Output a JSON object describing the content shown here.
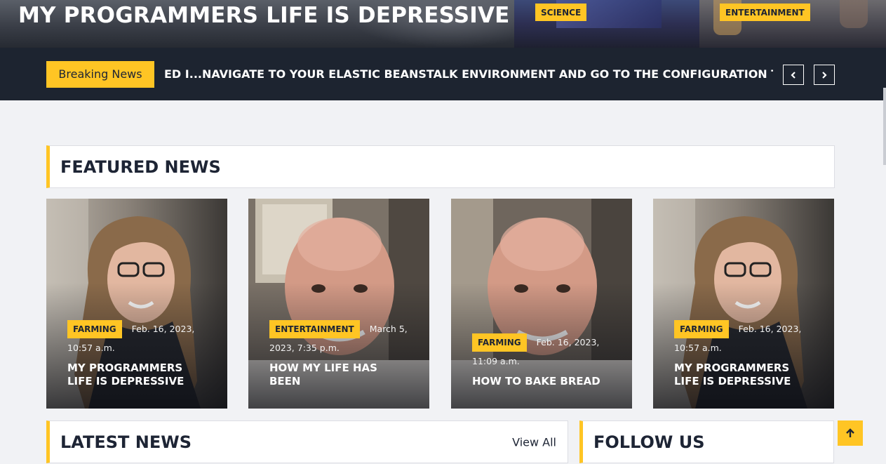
{
  "hero": {
    "title": "MY PROGRAMMERS LIFE IS DEPRESSIVE",
    "categories": [
      "SCIENCE",
      "ENTERTAINMENT"
    ]
  },
  "breaking": {
    "label": "Breaking News",
    "ticker_items": [
      "ED I...",
      "NAVIGATE TO YOUR ELASTIC BEANSTALK ENVIRONMENT AND GO TO THE CONFIGURATION TAB AN"
    ],
    "prev_icon": "chevron-left-icon",
    "next_icon": "chevron-right-icon"
  },
  "featured": {
    "title": "FEATURED NEWS",
    "cards": [
      {
        "category": "FARMING",
        "date": "Feb. 16, 2023, 10:57 a.m.",
        "headline": "MY PROGRAMMERS LIFE IS DEPRESSIVE"
      },
      {
        "category": "ENTERTAINMENT",
        "date": "March 5, 2023, 7:35 p.m.",
        "headline": "HOW MY LIFE HAS BEEN"
      },
      {
        "category": "FARMING",
        "date": "Feb. 16, 2023, 11:09 a.m.",
        "headline": "HOW TO BAKE BREAD"
      },
      {
        "category": "FARMING",
        "date": "Feb. 16, 2023, 10:57 a.m.",
        "headline": "MY PROGRAMMERS LIFE IS DEPRESSIVE"
      }
    ]
  },
  "latest": {
    "title": "LATEST NEWS",
    "view_all": "View All"
  },
  "follow": {
    "title": "FOLLOW US"
  },
  "colors": {
    "accent": "#ffc524",
    "dark": "#1d2434",
    "page_bg": "#f1f2f5"
  },
  "icons": {
    "back_to_top": "arrow-up-icon"
  }
}
